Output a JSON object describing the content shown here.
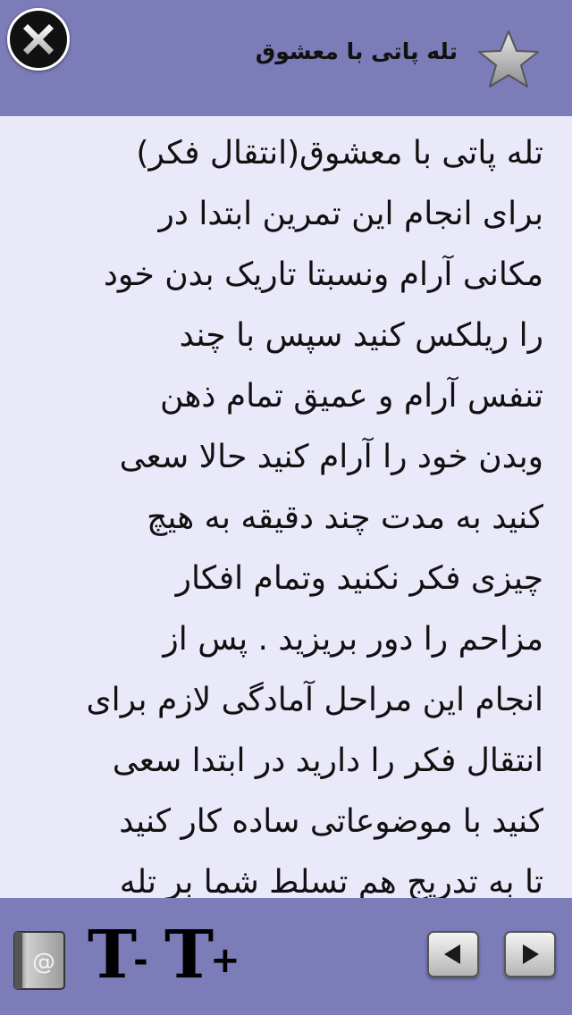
{
  "header": {
    "title": "تله پاتی با معشوق",
    "close_icon": "close-icon",
    "favorite_icon": "star-icon"
  },
  "content": {
    "lines": [
      "تله پاتی با معشوق(انتقال فکر)",
      "برای انجام این تمرین ابتدا در",
      "مکانی آرام ونسبتا تاریک بدن خود",
      "را ریلکس کنید سپس با چند",
      "تنفس آرام و عمیق تمام ذهن",
      "وبدن خود را آرام کنید حالا سعی",
      "کنید به مدت چند دقیقه به هیچ",
      "چیزی فکر نکنید وتمام افکار",
      "مزاحم را دور بریزید . پس از",
      "انجام این مراحل آمادگی لازم برای",
      "انتقال فکر را دارید در ابتدا سعی",
      "کنید با موضوعاتی ساده کار کنید",
      "تا به تدریج هم تسلط شما بر تله"
    ]
  },
  "footer": {
    "email_symbol": "@",
    "font_decrease": {
      "letter": "T",
      "sign": "-"
    },
    "font_increase": {
      "letter": "T",
      "sign": "+"
    },
    "prev_icon": "arrow-left-icon",
    "next_icon": "arrow-right-icon"
  },
  "colors": {
    "bar_background": "#7b7cb8",
    "content_background": "#e9e9f9",
    "text": "#111111"
  }
}
